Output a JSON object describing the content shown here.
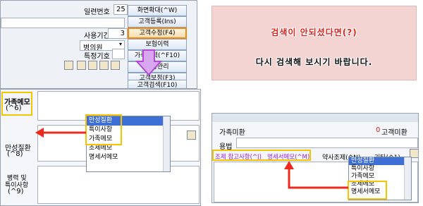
{
  "top_form": {
    "serial_label": "일련번호",
    "serial_value": "25",
    "period_label": "사용기간",
    "period_value": "3",
    "hospital_value": "병의원",
    "special_code_label": "특정기호"
  },
  "side_buttons": [
    "화면확대(^W)",
    "고객등록(Ins)",
    "고객수정(F4)",
    "보험이력",
    "가족현력(^F10)",
    "인증관리",
    "고객보정(F3)",
    "고객검색(F10)"
  ],
  "notice": {
    "line1": "검색이 안되셨다면(?)",
    "line2": "다시 검색해 보시기 바랍니다."
  },
  "left_panel": {
    "family_memo_label": "가족메모",
    "family_memo_key": "(^6)",
    "chronic_label": "만성질환",
    "chronic_key": "(^8)",
    "history_label_1": "병력 및",
    "history_label_2": "특이사항",
    "history_key": "(^9)"
  },
  "left_dropdown": {
    "items": [
      "만성질환",
      "특이사항",
      "가족메모",
      "조제메모",
      "명세서메모"
    ],
    "selected_index": 0
  },
  "right_panel": {
    "family_referral_label": "가족미환",
    "count_value": "0",
    "customer_referral_label": "고객미환",
    "usage_label": "용법",
    "tabs": [
      "조제 참고사항(^J)",
      "명세서메모(^M)",
      "약사조제(^N)",
      "기타(^1)"
    ]
  },
  "right_dropdown": {
    "items": [
      "만성질환",
      "특이사항",
      "가족메모",
      "조제메모",
      "명세서메모"
    ],
    "selected_index": 0
  },
  "colors": {
    "highlight_orange": "#f08a10",
    "callout_red": "#ec2a1f",
    "arrow_purple": "#b04ad6",
    "notice_bg": "#f4d3d3"
  }
}
